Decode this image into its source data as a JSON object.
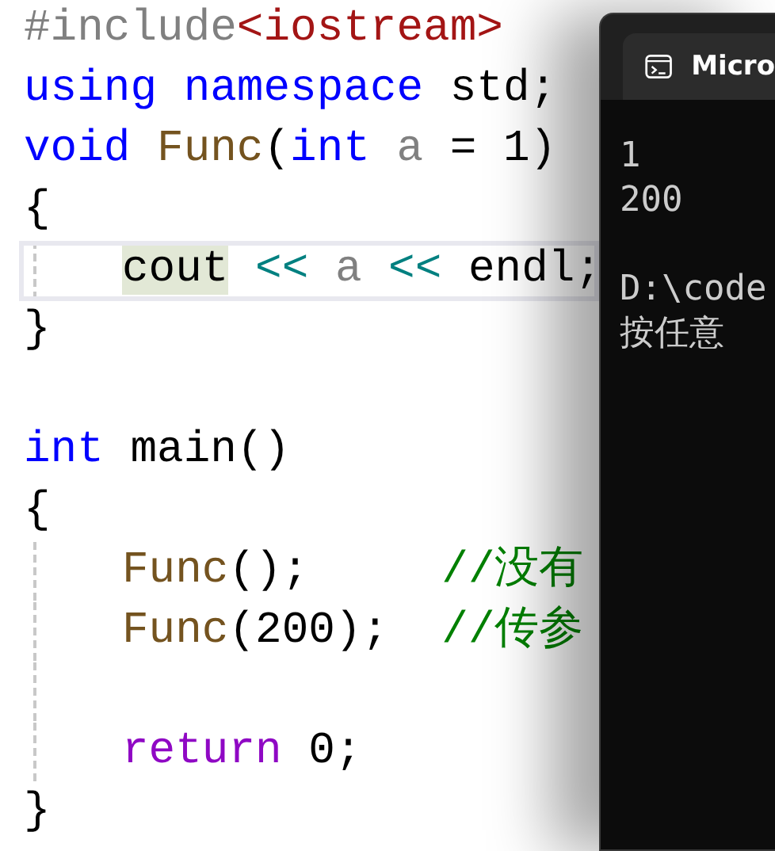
{
  "editor": {
    "lines": [
      {
        "tokens": [
          {
            "kind": "preprocessor",
            "text": "#include"
          },
          {
            "kind": "include_path",
            "text": "<iostream>"
          }
        ]
      },
      {
        "tokens": [
          {
            "kind": "keyword",
            "text": "using "
          },
          {
            "kind": "keyword",
            "text": "namespace "
          },
          {
            "kind": "plain",
            "text": "std;"
          }
        ]
      },
      {
        "tokens": [
          {
            "kind": "keyword",
            "text": "void "
          },
          {
            "kind": "function",
            "text": "Func"
          },
          {
            "kind": "plain",
            "text": "("
          },
          {
            "kind": "keyword",
            "text": "int "
          },
          {
            "kind": "parameter",
            "text": "a"
          },
          {
            "kind": "plain",
            "text": " = 1)"
          }
        ]
      },
      {
        "tokens": [
          {
            "kind": "brace",
            "text": "{"
          }
        ]
      },
      {
        "current": true,
        "indented": true,
        "tokens": [
          {
            "kind": "highlighted",
            "text": "cout"
          },
          {
            "kind": "operator",
            "text": " << "
          },
          {
            "kind": "parameter",
            "text": "a"
          },
          {
            "kind": "operator",
            "text": " << "
          },
          {
            "kind": "plain",
            "text": "endl;"
          }
        ]
      },
      {
        "tokens": [
          {
            "kind": "brace",
            "text": "}"
          }
        ]
      },
      {
        "kind": "blank"
      },
      {
        "tokens": [
          {
            "kind": "keyword",
            "text": "int "
          },
          {
            "kind": "plain",
            "text": "main()"
          }
        ]
      },
      {
        "tokens": [
          {
            "kind": "brace",
            "text": "{"
          }
        ]
      },
      {
        "indented": true,
        "tokens": [
          {
            "kind": "function",
            "text": "Func"
          },
          {
            "kind": "plain",
            "text": "();     "
          },
          {
            "kind": "comment",
            "text": "//没有"
          }
        ]
      },
      {
        "indented": true,
        "tokens": [
          {
            "kind": "function",
            "text": "Func"
          },
          {
            "kind": "plain",
            "text": "(200);  "
          },
          {
            "kind": "comment",
            "text": "//传参"
          }
        ]
      },
      {
        "kind": "blank",
        "indented": true
      },
      {
        "indented": true,
        "tokens": [
          {
            "kind": "return",
            "text": "return "
          },
          {
            "kind": "plain",
            "text": "0;"
          }
        ]
      },
      {
        "tokens": [
          {
            "kind": "brace",
            "text": "}"
          }
        ]
      }
    ]
  },
  "console": {
    "tab_title": "Micro",
    "output": [
      {
        "kind": "text",
        "text": "1"
      },
      {
        "kind": "text",
        "text": "200"
      },
      {
        "kind": "blank"
      },
      {
        "kind": "text",
        "text": "D:\\code"
      },
      {
        "kind": "text",
        "text": "按任意"
      }
    ]
  }
}
